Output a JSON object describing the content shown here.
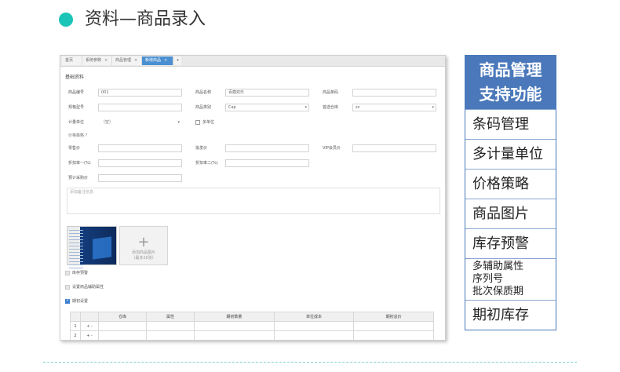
{
  "heading": {
    "title": "资料—商品录入"
  },
  "tabs": [
    {
      "label": "首页",
      "closable": false
    },
    {
      "label": "系统参数",
      "closable": true
    },
    {
      "label": "商品管理",
      "closable": true
    },
    {
      "label": "新增商品",
      "closable": true,
      "active": true
    }
  ],
  "tabs_more": "▾",
  "form": {
    "section_basic": "基础资料",
    "code_label": "商品编号",
    "code_value": "001",
    "name_label": "商品名称",
    "name_value": "百蕴双乐",
    "barcode_label": "商品条码",
    "barcode_value": "",
    "spec_label": "规格型号",
    "spec_value": "",
    "category_label": "商品类别",
    "category_value": "Cap",
    "warehouse_label": "首选仓库",
    "warehouse_value": "sz",
    "unit_label": "计量单位",
    "unit_value": "（空）",
    "multi_unit_label": "多单位",
    "price_strategy": "价格策略 ?",
    "retail_label": "零售价",
    "wholesale_label": "批发价",
    "vip_label": "VIP会员价",
    "discount1_label": "折扣率一(%)",
    "discount2_label": "折扣率二(%)",
    "purchase_label": "预计采购价",
    "memo_placeholder": "添加备注信息",
    "add_image_line1": "添加商品图片",
    "add_image_line2": "（最多20张）",
    "stock_alert_label": "库存预警",
    "aux_attr_label": "设置商品辅助属性",
    "initial_label": "期初设置"
  },
  "grid": {
    "headers": [
      "",
      "",
      "仓库",
      "属性",
      "期初数量",
      "单位成本",
      "期初总价"
    ],
    "rows": [
      {
        "index": "1",
        "ops": "+ -"
      },
      {
        "index": "2",
        "ops": "+ -"
      }
    ]
  },
  "features": {
    "title_line1": "商品管理",
    "title_line2": "支持功能",
    "items": [
      "条码管理",
      "多计量单位",
      "价格策略",
      "商品图片",
      "库存预警"
    ],
    "multi": [
      "多辅助属性",
      "序列号",
      "批次保质期"
    ],
    "last": "期初库存"
  },
  "colors": {
    "accent_dot": "#1cc4b8",
    "feature_header": "#4a78ba",
    "active_tab": "#4a8fd1"
  }
}
